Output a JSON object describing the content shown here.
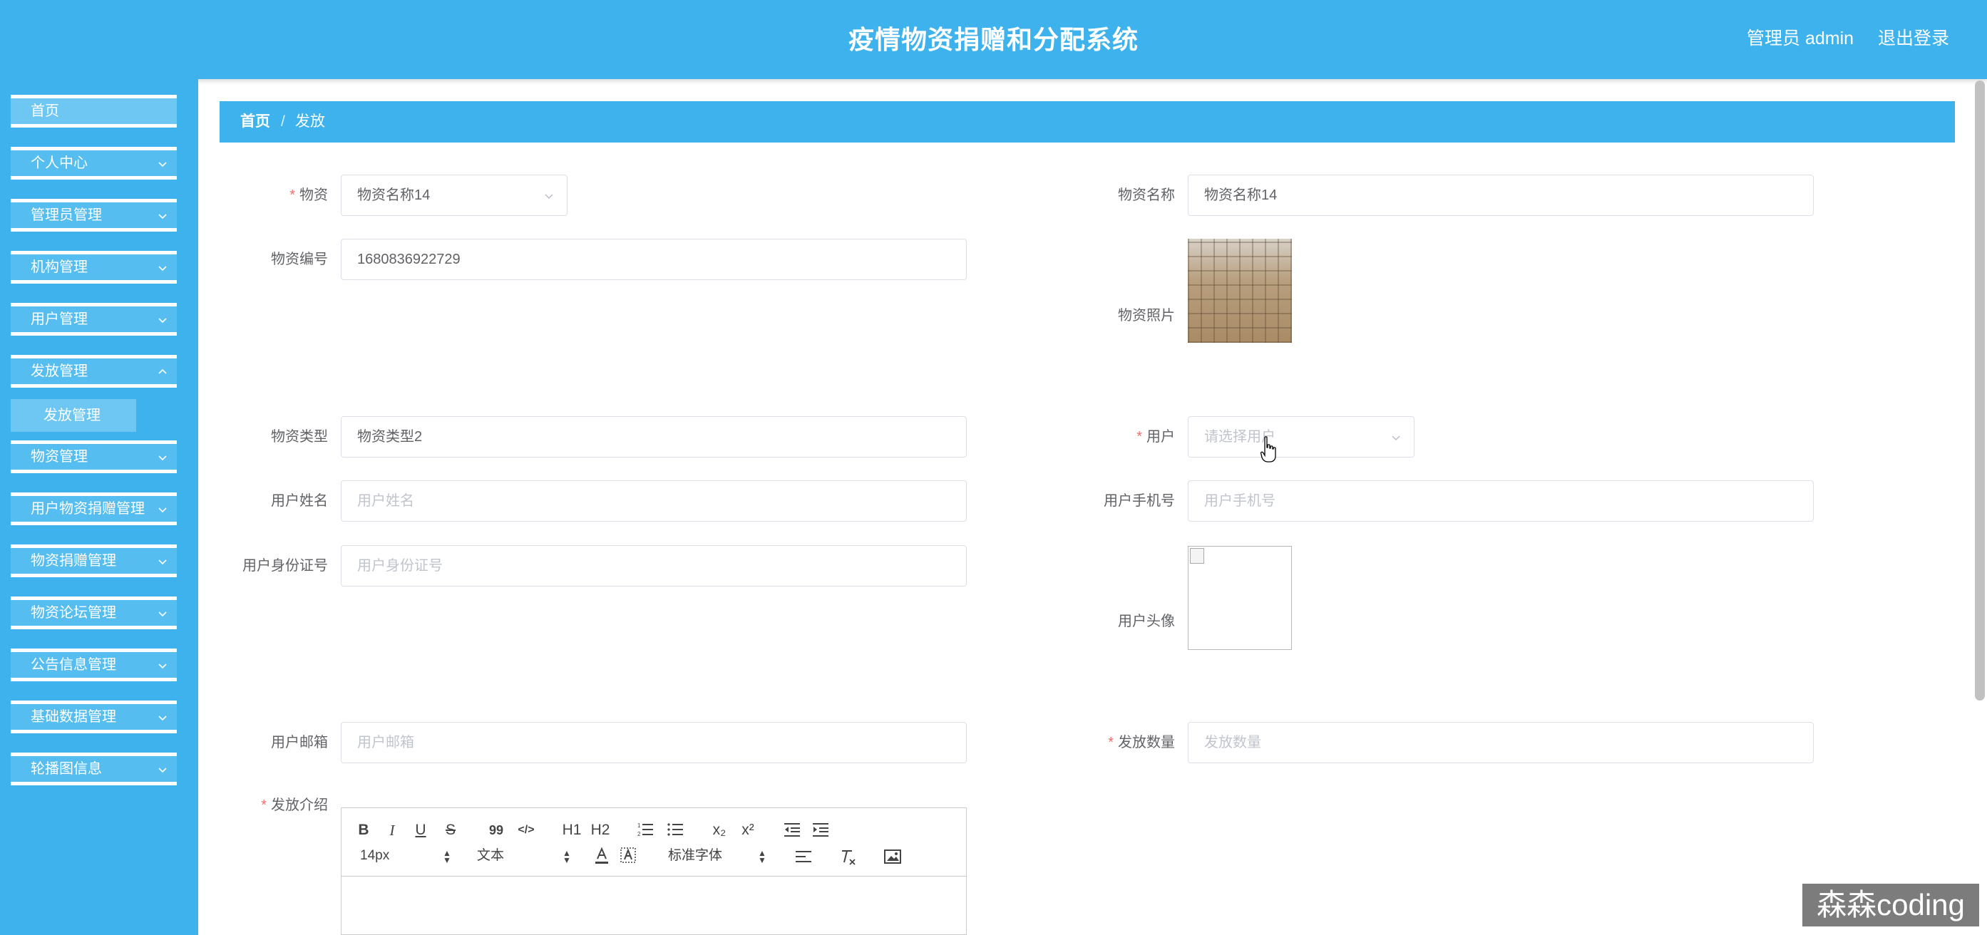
{
  "header": {
    "title": "疫情物资捐赠和分配系统",
    "admin": "管理员 admin",
    "logout": "退出登录"
  },
  "sidebar": {
    "items": [
      {
        "label": "首页"
      },
      {
        "label": "个人中心"
      },
      {
        "label": "管理员管理"
      },
      {
        "label": "机构管理"
      },
      {
        "label": "用户管理"
      },
      {
        "label": "发放管理"
      },
      {
        "label": "物资管理"
      },
      {
        "label": "用户物资捐赠管理"
      },
      {
        "label": "物资捐赠管理"
      },
      {
        "label": "物资论坛管理"
      },
      {
        "label": "公告信息管理"
      },
      {
        "label": "基础数据管理"
      },
      {
        "label": "轮播图信息"
      }
    ],
    "submenu": {
      "label": "发放管理"
    }
  },
  "breadcrumb": {
    "home": "首页",
    "separator": "/",
    "current": "发放"
  },
  "form": {
    "wuzi": {
      "label": "物资",
      "value": "物资名称14"
    },
    "wuzi_name": {
      "label": "物资名称",
      "value": "物资名称14"
    },
    "wuzi_code": {
      "label": "物资编号",
      "value": "1680836922729"
    },
    "wuzi_photo": {
      "label": "物资照片"
    },
    "wuzi_type": {
      "label": "物资类型",
      "value": "物资类型2"
    },
    "user": {
      "label": "用户",
      "placeholder": "请选择用户"
    },
    "user_name": {
      "label": "用户姓名",
      "placeholder": "用户姓名"
    },
    "user_phone": {
      "label": "用户手机号",
      "placeholder": "用户手机号"
    },
    "user_id": {
      "label": "用户身份证号",
      "placeholder": "用户身份证号"
    },
    "user_avatar": {
      "label": "用户头像"
    },
    "user_email": {
      "label": "用户邮箱",
      "placeholder": "用户邮箱"
    },
    "quantity": {
      "label": "发放数量",
      "placeholder": "发放数量"
    },
    "intro": {
      "label": "发放介绍"
    },
    "required_mark": "*"
  },
  "editor": {
    "toolbar_row1": [
      "B",
      "I",
      "U",
      "S",
      "99",
      "</>",
      "H1",
      "H2",
      "ol",
      "ul",
      "x₂",
      "x²",
      "outdent",
      "indent"
    ],
    "font_size": "14px",
    "header_select": "文本",
    "font_family": "标准字体"
  },
  "watermark": "森森coding",
  "colors": {
    "primary": "#3db2ec",
    "menu_item": "#55bdf0",
    "required": "#f56c6c"
  }
}
